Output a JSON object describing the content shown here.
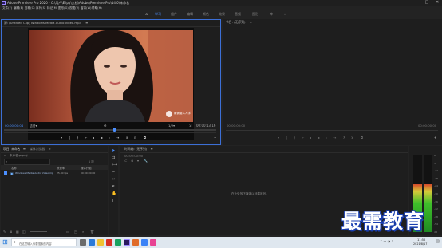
{
  "window": {
    "title": "Adobe Premiere Pro 2020 - C:\\用户\\Elipy\\文档\\Adobe\\Premiere Pro\\14.0\\未命名",
    "min": "–",
    "max": "□",
    "close": "✕"
  },
  "menu": [
    "文件(F)",
    "编辑(E)",
    "剪辑(C)",
    "序列(S)",
    "标记(M)",
    "图形(G)",
    "视图(V)",
    "窗口(W)",
    "帮助(H)"
  ],
  "workspace": {
    "home": "⌂",
    "tabs": [
      "学习",
      "组件",
      "编辑",
      "颜色",
      "效果",
      "音频",
      "图形",
      "库"
    ],
    "more": "»",
    "active_index": 0
  },
  "source": {
    "tab": "源: (Untitled Clip) Windows Media Audio Video.mp4",
    "menu": "≡",
    "timecode_left": "00:00:00:04",
    "fit": "适合",
    "fit_caret": "▾",
    "quality": "1/2",
    "quality_caret": "▾",
    "timecode_right": "00:00:13:16",
    "video_watermark": "最需要人人学",
    "playhead_pos": 0.52
  },
  "program": {
    "tab": "节目: (无序列)",
    "menu": "≡",
    "timecode_left": "00:00:00:00",
    "timecode_right": "00:00:00:00"
  },
  "project": {
    "tab_active": "项目: 未命名",
    "tab_menu": "≡",
    "tab_inactive": "媒体浏览器",
    "more": "»",
    "path": "未命名.prproj",
    "search_placeholder": "",
    "item_count": "1 项",
    "columns": [
      "名称",
      "帧速率",
      "媒体开始"
    ],
    "rows": [
      {
        "name": "Windows Media Audio Video.mp4",
        "fps": "25.00 fps",
        "start": "00:00:00:00"
      }
    ]
  },
  "timeline": {
    "tab": "时间轴: (无序列)",
    "menu": "≡",
    "timecode": "00:00:00:00",
    "placeholder": "在此处放下媒体以创建序列。"
  },
  "audio": {
    "scale": [
      "0",
      "-6",
      "-12",
      "-18",
      "-24",
      "-30",
      "-36",
      "-42",
      "-48",
      "-54",
      "dB"
    ],
    "level_left": 0.62,
    "level_right": 0.62
  },
  "taskbar": {
    "search": "在这里输入你要搜索的内容",
    "time": "11:52",
    "date": "2021/8/17"
  },
  "colors": {
    "accent": "#4b8fff",
    "panel_bg": "#1e1e1e",
    "app_bg": "#232323",
    "taskbar": "#dfe7ef"
  },
  "watermark": "最需教育"
}
